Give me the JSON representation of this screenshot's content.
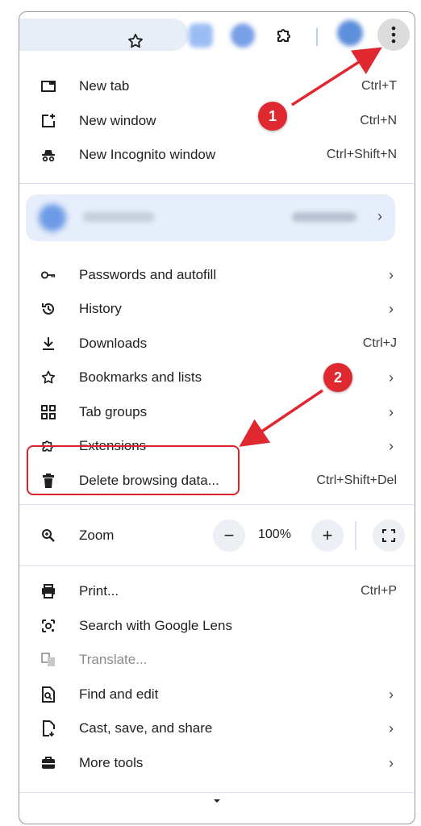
{
  "menu": {
    "items_top": [
      {
        "label": "New tab",
        "shortcut": "Ctrl+T",
        "icon": "new-tab-icon"
      },
      {
        "label": "New window",
        "shortcut": "Ctrl+N",
        "icon": "new-window-icon"
      },
      {
        "label": "New Incognito window",
        "shortcut": "Ctrl+Shift+N",
        "icon": "incognito-icon"
      }
    ],
    "items_mid": [
      {
        "label": "Passwords and autofill",
        "icon": "key-icon"
      },
      {
        "label": "History",
        "icon": "history-icon"
      },
      {
        "label": "Downloads",
        "shortcut": "Ctrl+J",
        "icon": "download-icon"
      },
      {
        "label": "Bookmarks and lists",
        "icon": "star-icon"
      },
      {
        "label": "Tab groups",
        "icon": "tab-groups-icon"
      },
      {
        "label": "Extensions",
        "icon": "puzzle-icon"
      },
      {
        "label": "Delete browsing data...",
        "shortcut": "Ctrl+Shift+Del",
        "icon": "trash-icon"
      }
    ],
    "zoom": {
      "label": "Zoom",
      "minus": "−",
      "value": "100%",
      "plus": "+",
      "icon": "zoom-icon"
    },
    "items_bottom": [
      {
        "label": "Print...",
        "shortcut": "Ctrl+P",
        "icon": "print-icon"
      },
      {
        "label": "Search with Google Lens",
        "icon": "lens-icon"
      },
      {
        "label": "Translate...",
        "icon": "translate-icon",
        "disabled": true
      },
      {
        "label": "Find and edit",
        "icon": "find-icon"
      },
      {
        "label": "Cast, save, and share",
        "icon": "cast-icon"
      },
      {
        "label": "More tools",
        "icon": "toolbox-icon"
      }
    ],
    "chevron": "›"
  },
  "annotations": {
    "step1": "1",
    "step2": "2",
    "accent_color": "#e02830"
  }
}
